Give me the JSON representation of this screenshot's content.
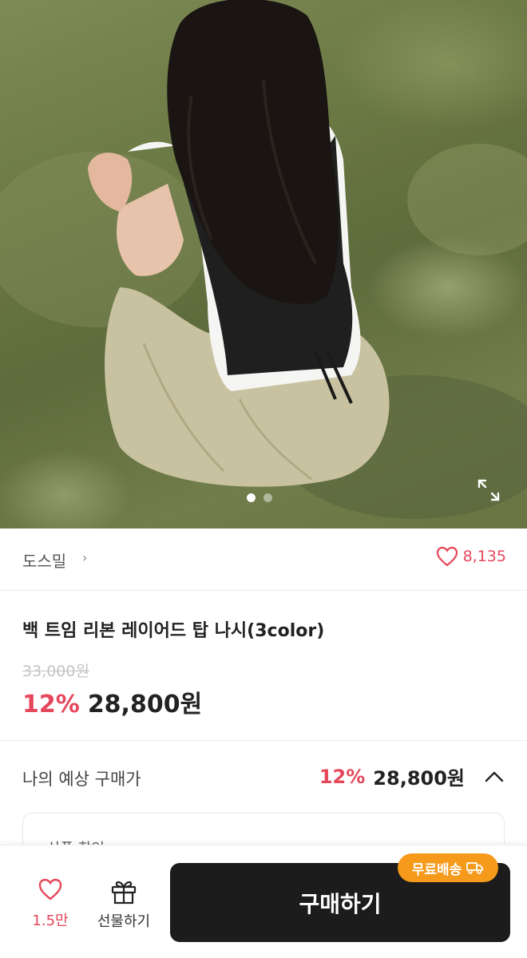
{
  "hero": {
    "image_alt": "product-photo",
    "page_indicator": {
      "total": 2,
      "current": 1
    }
  },
  "seller": {
    "name": "도스밀",
    "chevron": "›",
    "like_count": "8,135"
  },
  "product": {
    "title": "백 트임 리본 레이어드 탑 나시(3color)",
    "original_price": "33,000원",
    "discount": "12%",
    "price": "28,800원"
  },
  "expected_price": {
    "label": "나의 예상 구매가",
    "discount": "12%",
    "price": "28,800원",
    "detail_label": "상품 할인"
  },
  "bottom_bar": {
    "wish_count": "1.5만",
    "gift_label": "선물하기",
    "buy_label": "구매하기",
    "shipping_badge": "무료배송"
  },
  "colors": {
    "accent": "#e5475b",
    "buy_button": "#1c1c1c",
    "shipping_badge": "#f59a1b"
  },
  "icons": [
    "expand-icon",
    "heart-icon",
    "chevron-right-icon",
    "chevron-up-icon",
    "gift-icon",
    "truck-icon"
  ]
}
